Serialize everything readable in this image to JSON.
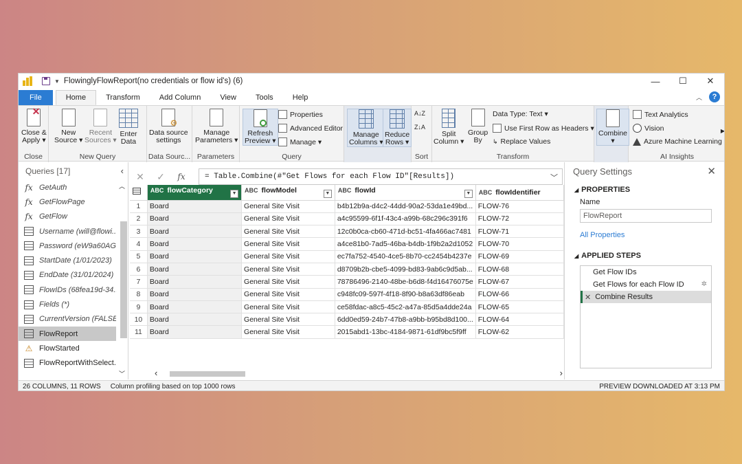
{
  "window": {
    "title": "FlowinglyFlowReport(no credentials or flow id's) (6)",
    "controls": [
      "—",
      "☐",
      "✕"
    ]
  },
  "tabs": [
    "File",
    "Home",
    "Transform",
    "Add Column",
    "View",
    "Tools",
    "Help"
  ],
  "ribbon": {
    "close": {
      "close_apply": "Close &",
      "close_apply2": "Apply ▾",
      "group": "Close"
    },
    "new_query": {
      "new_source": "New",
      "new_source2": "Source ▾",
      "recent_sources": "Recent",
      "recent_sources2": "Sources ▾",
      "enter_data": "Enter",
      "enter_data2": "Data",
      "group": "New Query"
    },
    "data_sources": {
      "btn": "Data source",
      "btn2": "settings",
      "group": "Data Sourc..."
    },
    "parameters": {
      "btn": "Manage",
      "btn2": "Parameters ▾",
      "group": "Parameters"
    },
    "query": {
      "refresh": "Refresh",
      "refresh2": "Preview ▾",
      "properties": "Properties",
      "advanced_editor": "Advanced Editor",
      "manage": "Manage ▾",
      "group": "Query"
    },
    "manage_columns": {
      "btn": "Manage",
      "btn2": "Columns ▾",
      "reduce": "Reduce",
      "reduce2": "Rows ▾"
    },
    "sort": {
      "group": "Sort",
      "az": "A↓Z",
      "za": "Z↓A"
    },
    "transform": {
      "split": "Split",
      "split2": "Column ▾",
      "group_by": "Group",
      "group_by2": "By",
      "data_type": "Data Type: Text ▾",
      "first_row": "Use First Row as Headers ▾",
      "replace": "Replace Values",
      "group": "Transform"
    },
    "combine": {
      "btn": "Combine",
      "btn2": "▾"
    },
    "ai": {
      "text_analytics": "Text Analytics",
      "vision": "Vision",
      "azure_ml": "Azure Machine Learning",
      "group": "AI Insights"
    }
  },
  "queries": {
    "header": "Queries [17]",
    "items": [
      {
        "icon": "fx",
        "label": "GetAuth",
        "type": "function"
      },
      {
        "icon": "fx",
        "label": "GetFlowPage",
        "type": "function"
      },
      {
        "icon": "fx",
        "label": "GetFlow",
        "type": "function"
      },
      {
        "icon": "table",
        "label": "Username (will@flowi...",
        "type": "param"
      },
      {
        "icon": "table",
        "label": "Password (eW9a60AG...",
        "type": "param"
      },
      {
        "icon": "table",
        "label": "StartDate (1/01/2023)",
        "type": "param"
      },
      {
        "icon": "table",
        "label": "EndDate (31/01/2024)",
        "type": "param"
      },
      {
        "icon": "table",
        "label": "FlowIDs (68fea19d-34...",
        "type": "param"
      },
      {
        "icon": "table",
        "label": "Fields (*)",
        "type": "param"
      },
      {
        "icon": "table",
        "label": "CurrentVersion (FALSE)",
        "type": "param"
      },
      {
        "icon": "table",
        "label": "FlowReport",
        "type": "table",
        "selected": true
      },
      {
        "icon": "warning",
        "label": "FlowStarted",
        "type": "table"
      },
      {
        "icon": "table",
        "label": "FlowReportWithSelect...",
        "type": "table"
      }
    ]
  },
  "formula": {
    "cancel": "✕",
    "commit": "✓",
    "fx": "fx",
    "text": "= Table.Combine(#\"Get Flows for each Flow ID\"[Results])"
  },
  "grid": {
    "columns": [
      "flowCategory",
      "flowModel",
      "flowId",
      "flowIdentifier"
    ],
    "rows": [
      [
        "1",
        "Board",
        "General Site Visit",
        "b4b12b9a-d4c2-44dd-90a2-53da1e49bd...",
        "FLOW-76"
      ],
      [
        "2",
        "Board",
        "General Site Visit",
        "a4c95599-6f1f-43c4-a99b-68c296c391f6",
        "FLOW-72"
      ],
      [
        "3",
        "Board",
        "General Site Visit",
        "12c0b0ca-cb60-471d-bc51-4fa466ac7481",
        "FLOW-71"
      ],
      [
        "4",
        "Board",
        "General Site Visit",
        "a4ce81b0-7ad5-46ba-b4db-1f9b2a2d1052",
        "FLOW-70"
      ],
      [
        "5",
        "Board",
        "General Site Visit",
        "ec7fa752-4540-4ce5-8b70-cc2454b4237e",
        "FLOW-69"
      ],
      [
        "6",
        "Board",
        "General Site Visit",
        "d8709b2b-cbe5-4099-bd83-9ab6c9d5ab...",
        "FLOW-68"
      ],
      [
        "7",
        "Board",
        "General Site Visit",
        "78786496-2140-48be-b6d8-f4d16476075e",
        "FLOW-67"
      ],
      [
        "8",
        "Board",
        "General Site Visit",
        "c948fc09-597f-4f18-8f90-b8a63df86eab",
        "FLOW-66"
      ],
      [
        "9",
        "Board",
        "General Site Visit",
        "ce58fdac-a8c5-45c2-a47a-85d5a4dde24a",
        "FLOW-65"
      ],
      [
        "10",
        "Board",
        "General Site Visit",
        "6dd0ed59-24b7-47b8-a9bb-b95bd8d100...",
        "FLOW-64"
      ],
      [
        "11",
        "Board",
        "General Site Visit",
        "2015abd1-13bc-4184-9871-61df9bc5f9ff",
        "FLOW-62"
      ]
    ]
  },
  "settings": {
    "title": "Query Settings",
    "properties_header": "PROPERTIES",
    "name_label": "Name",
    "name_value": "FlowReport",
    "all_properties": "All Properties",
    "steps_header": "APPLIED STEPS",
    "steps": [
      {
        "label": "Get Flow IDs",
        "selected": false
      },
      {
        "label": "Get Flows for each Flow ID",
        "selected": false,
        "gear": true
      },
      {
        "label": "Combine Results",
        "selected": true
      }
    ]
  },
  "status": {
    "columns_rows": "26 COLUMNS, 11 ROWS",
    "profiling": "Column profiling based on top 1000 rows",
    "preview": "PREVIEW DOWNLOADED AT 3:13 PM"
  }
}
